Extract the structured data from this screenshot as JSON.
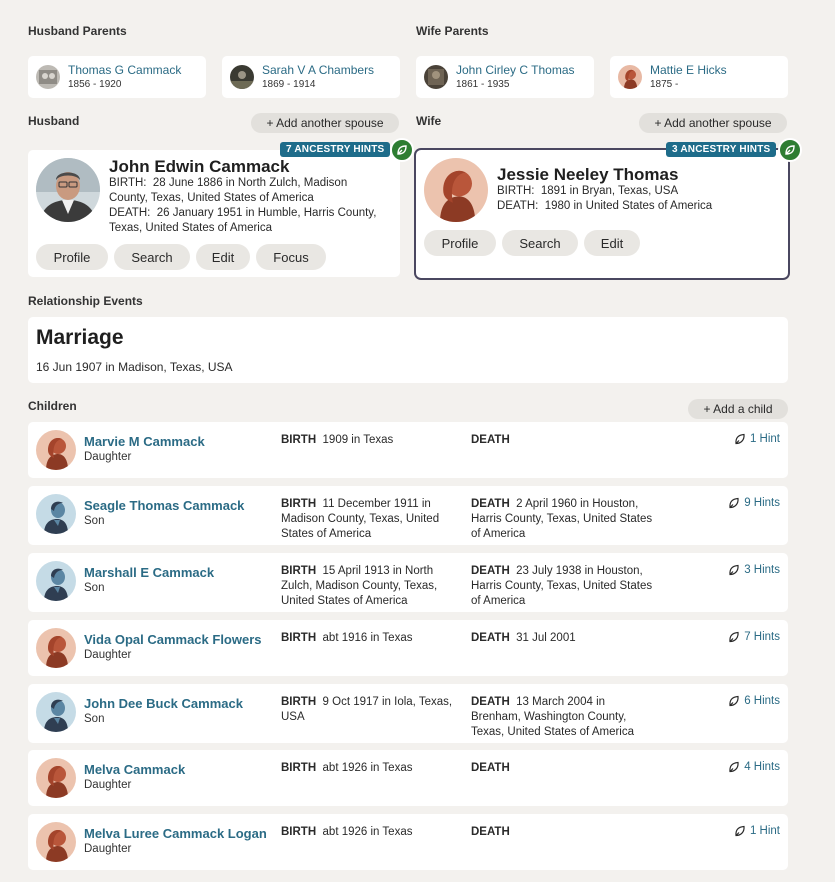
{
  "husband_parents": {
    "title": "Husband Parents",
    "father": {
      "name": "Thomas G Cammack",
      "dates": "1856 - 1920"
    },
    "mother": {
      "name": "Sarah V A Chambers",
      "dates": "1869 - 1914"
    }
  },
  "wife_parents": {
    "title": "Wife Parents",
    "father": {
      "name": "John Cirley C Thomas",
      "dates": "1861 - 1935"
    },
    "mother": {
      "name": "Mattie E Hicks",
      "dates": "1875 -"
    }
  },
  "husband": {
    "title": "Husband",
    "add_spouse": "+ Add another spouse",
    "hints": "7 ANCESTRY HINTS",
    "name": "John Edwin Cammack",
    "birth_label": "BIRTH:",
    "birth": "28 June 1886 in North Zulch, Madison County, Texas, United States of America",
    "death_label": "DEATH:",
    "death": "26 January 1951 in Humble, Harris County, Texas, United States of America",
    "buttons": {
      "profile": "Profile",
      "search": "Search",
      "edit": "Edit",
      "focus": "Focus"
    }
  },
  "wife": {
    "title": "Wife",
    "add_spouse": "+ Add another spouse",
    "hints": "3 ANCESTRY HINTS",
    "name": "Jessie Neeley Thomas",
    "birth_label": "BIRTH:",
    "birth": "1891 in Bryan, Texas, USA",
    "death_label": "DEATH:",
    "death": "1980 in United States of America",
    "buttons": {
      "profile": "Profile",
      "search": "Search",
      "edit": "Edit"
    }
  },
  "relationship": {
    "title": "Relationship Events",
    "event": "Marriage",
    "detail": "16 Jun 1907 in Madison, Texas, USA"
  },
  "children_section": {
    "title": "Children",
    "add_child": "+ Add a child",
    "birth_label": "BIRTH",
    "death_label": "DEATH"
  },
  "children": [
    {
      "name": "Marvie M Cammack",
      "relation": "Daughter",
      "birth": "1909  in Texas",
      "death": "",
      "hints": "1 Hint",
      "gender": "f"
    },
    {
      "name": "Seagle Thomas Cammack",
      "relation": "Son",
      "birth": "11 December 1911  in Madison County, Texas, United States of America",
      "death": "2 April 1960  in Houston, Harris County, Texas, United States of America",
      "hints": "9 Hints",
      "gender": "m"
    },
    {
      "name": "Marshall E Cammack",
      "relation": "Son",
      "birth": "15 April 1913  in North Zulch, Madison County, Texas, United States of America",
      "death": "23 July 1938  in Houston, Harris County, Texas, United States of America",
      "hints": "3 Hints",
      "gender": "m"
    },
    {
      "name": "Vida Opal Cammack Flowers",
      "relation": "Daughter",
      "birth": "abt 1916  in Texas",
      "death": "31 Jul 2001",
      "hints": "7 Hints",
      "gender": "f"
    },
    {
      "name": "John Dee Buck Cammack",
      "relation": "Son",
      "birth": "9 Oct 1917  in Iola, Texas, USA",
      "death": "13 March 2004  in Brenham, Washington County, Texas, United States of America",
      "hints": "6 Hints",
      "gender": "m"
    },
    {
      "name": "Melva Cammack",
      "relation": "Daughter",
      "birth": "abt 1926  in Texas",
      "death": "",
      "hints": "4 Hints",
      "gender": "f"
    },
    {
      "name": "Melva Luree Cammack Logan",
      "relation": "Daughter",
      "birth": "abt 1926  in Texas",
      "death": "",
      "hints": "1 Hint",
      "gender": "f"
    }
  ],
  "colors": {
    "link": "#2b6b85",
    "hint_badge": "#1e6c8a",
    "leaf": "#2e7d32",
    "background": "#f3f1ee"
  }
}
